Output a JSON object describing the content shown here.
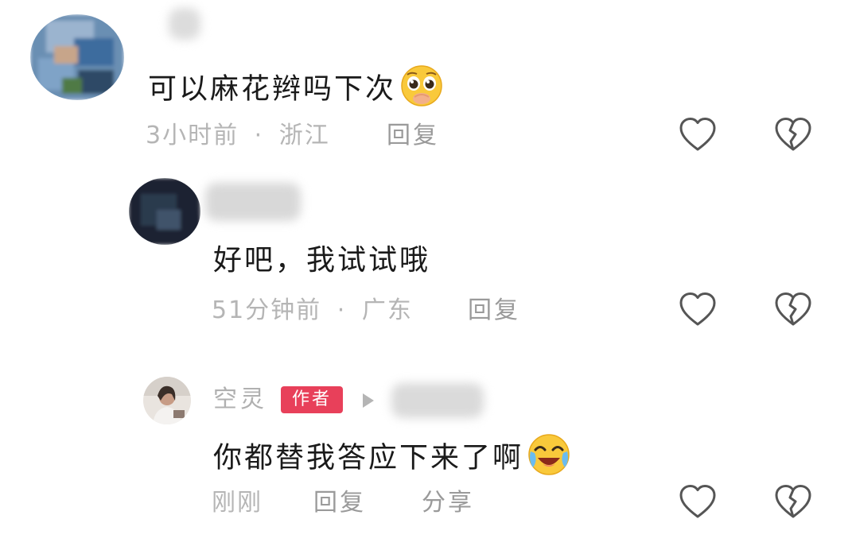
{
  "comments": [
    {
      "text": "可以麻花辫吗下次",
      "emoji": "pleading-face",
      "time": "3小时前",
      "separator": "·",
      "location": "浙江",
      "reply_label": "回复",
      "like_icon": "heart-outline-icon",
      "dislike_icon": "broken-heart-icon"
    },
    {
      "text": "好吧，我试试哦",
      "time": "51分钟前",
      "separator": "·",
      "location": "广东",
      "reply_label": "回复",
      "like_icon": "heart-outline-icon",
      "dislike_icon": "broken-heart-icon"
    },
    {
      "author_name": "空灵",
      "author_badge": "作者",
      "text": "你都替我答应下来了啊",
      "emoji": "tears-of-joy-face",
      "time": "刚刚",
      "reply_label": "回复",
      "share_label": "分享",
      "like_icon": "heart-outline-icon",
      "dislike_icon": "broken-heart-icon"
    }
  ],
  "colors": {
    "badge": "#e8405a",
    "meta_text": "#b5b5b5",
    "icon_stroke": "#555555"
  }
}
